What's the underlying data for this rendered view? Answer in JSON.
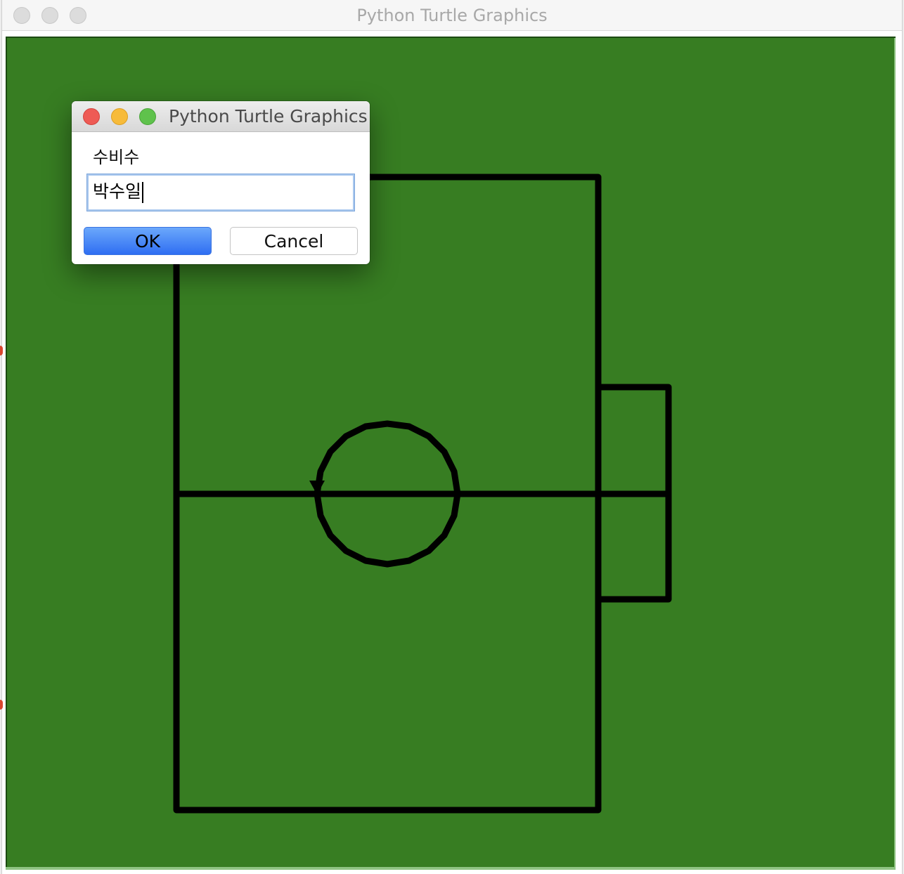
{
  "window": {
    "title": "Python Turtle Graphics"
  },
  "canvas": {
    "background_color": "#377d22",
    "pen_color": "#000000"
  },
  "dialog": {
    "title": "Python Turtle Graphics",
    "prompt": "수비수",
    "input_value": "박수일",
    "ok_label": "OK",
    "cancel_label": "Cancel"
  }
}
